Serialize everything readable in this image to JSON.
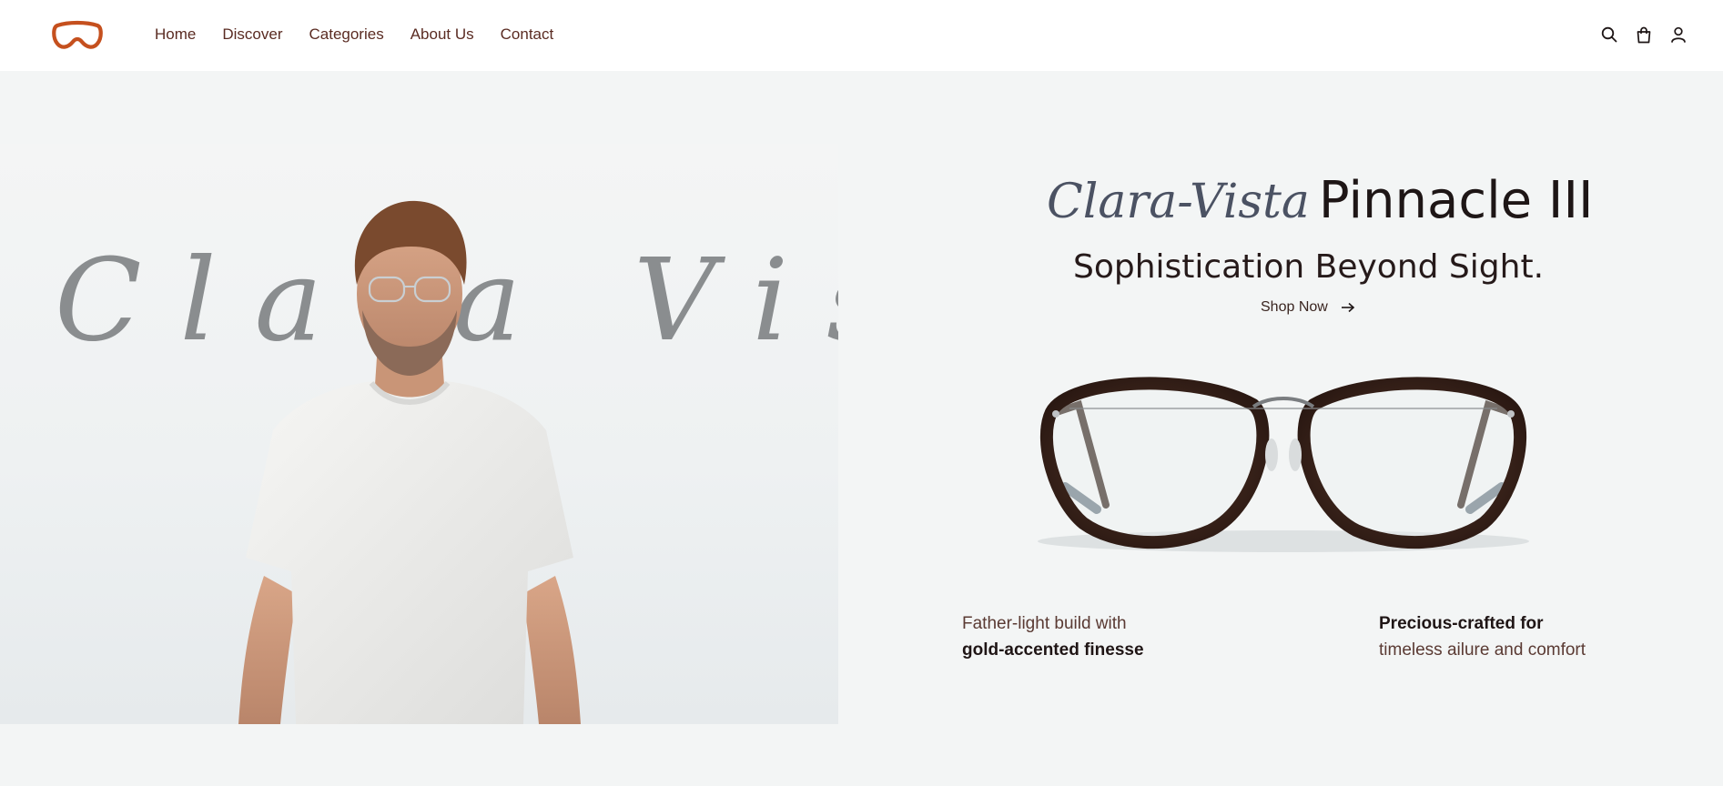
{
  "header": {
    "logo_icon": "goggles-logo-icon",
    "nav": [
      "Home",
      "Discover",
      "Categories",
      "About Us",
      "Contact"
    ],
    "icons": [
      "search-icon",
      "shopping-bag-icon",
      "user-icon"
    ]
  },
  "hero": {
    "script_word": "Clara Vista",
    "brand": "Clara-Vista",
    "model_name": "Pinnacle III",
    "tagline": "Sophistication Beyond Sight.",
    "cta_label": "Shop Now",
    "cta_icon": "arrow-right-icon"
  },
  "features": [
    {
      "line1": "Father-light build with",
      "line2": "gold-accented finesse"
    },
    {
      "line1": "Precious-crafted for",
      "line2": "timeless ailure and comfort"
    }
  ],
  "colors": {
    "accent": "#c5501e",
    "text_dark": "#1e1616",
    "nav_text": "#5a2b22",
    "brand_script": "#4b5263",
    "background": "#f3f5f5"
  }
}
